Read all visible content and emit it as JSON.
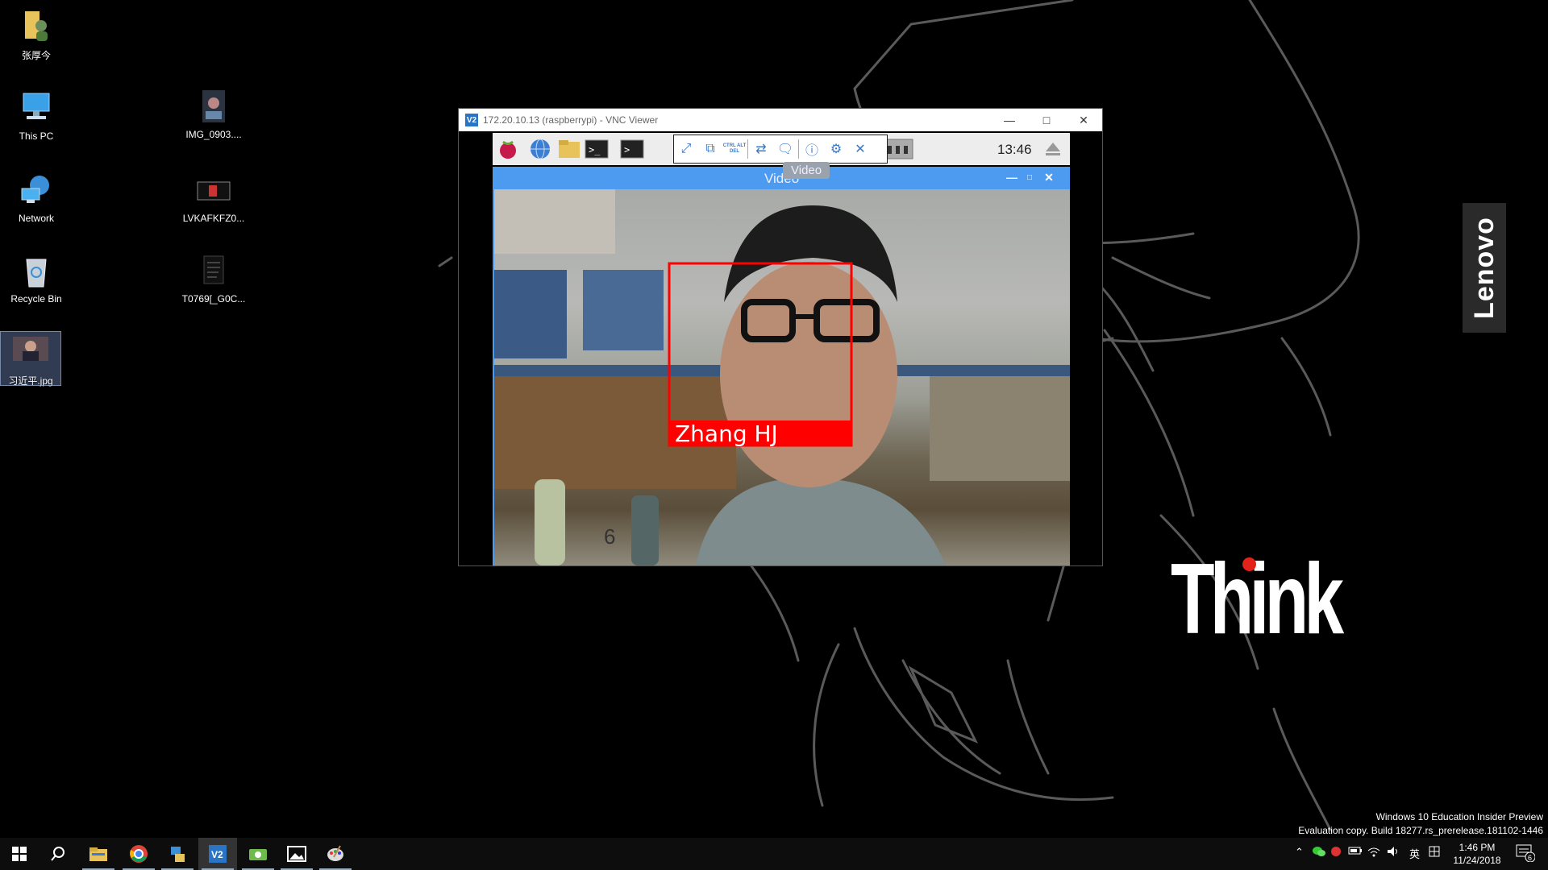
{
  "desktop": {
    "icons": [
      {
        "label": "张厚今",
        "icon": "user-folder-icon"
      },
      {
        "label": "This PC",
        "icon": "computer-icon"
      },
      {
        "label": "Network",
        "icon": "network-icon"
      },
      {
        "label": "Recycle Bin",
        "icon": "recycle-bin-icon"
      },
      {
        "label": "习近平.jpg",
        "icon": "image-file-icon"
      },
      {
        "label": "IMG_0903....",
        "icon": "image-file-icon"
      },
      {
        "label": "LVKAFKFZ0...",
        "icon": "image-file-icon"
      },
      {
        "label": "T0769[_G0C...",
        "icon": "document-icon"
      }
    ],
    "brand": {
      "lenovo": "Lenovo",
      "think": "Think",
      "accent": "#e2231a"
    },
    "watermark": {
      "line1": "Windows 10 Education Insider Preview",
      "line2": "Evaluation copy. Build 18277.rs_prerelease.181102-1446"
    }
  },
  "vnc": {
    "title": "172.20.10.13 (raspberrypi) - VNC Viewer",
    "app_icon_text": "V2",
    "clock": "13:46",
    "tooltip": "Video",
    "toolbar_ctrl_alt_del": "CTRL ALT DEL",
    "video_window": {
      "title": "Video",
      "frame_digit": "6",
      "face_label": "Zhang  HJ",
      "box_color": "#ff0000",
      "title_bar_color": "#4d9bf0"
    }
  },
  "taskbar": {
    "time": "1:46 PM",
    "date": "11/24/2018",
    "ime": "英",
    "notifications": "6",
    "apps": [
      "windows-start-icon",
      "search-icon",
      "file-explorer-icon",
      "chrome-icon",
      "network-tool-icon",
      "vnc-viewer-icon",
      "app-green-icon",
      "photos-icon",
      "paint-icon"
    ]
  }
}
